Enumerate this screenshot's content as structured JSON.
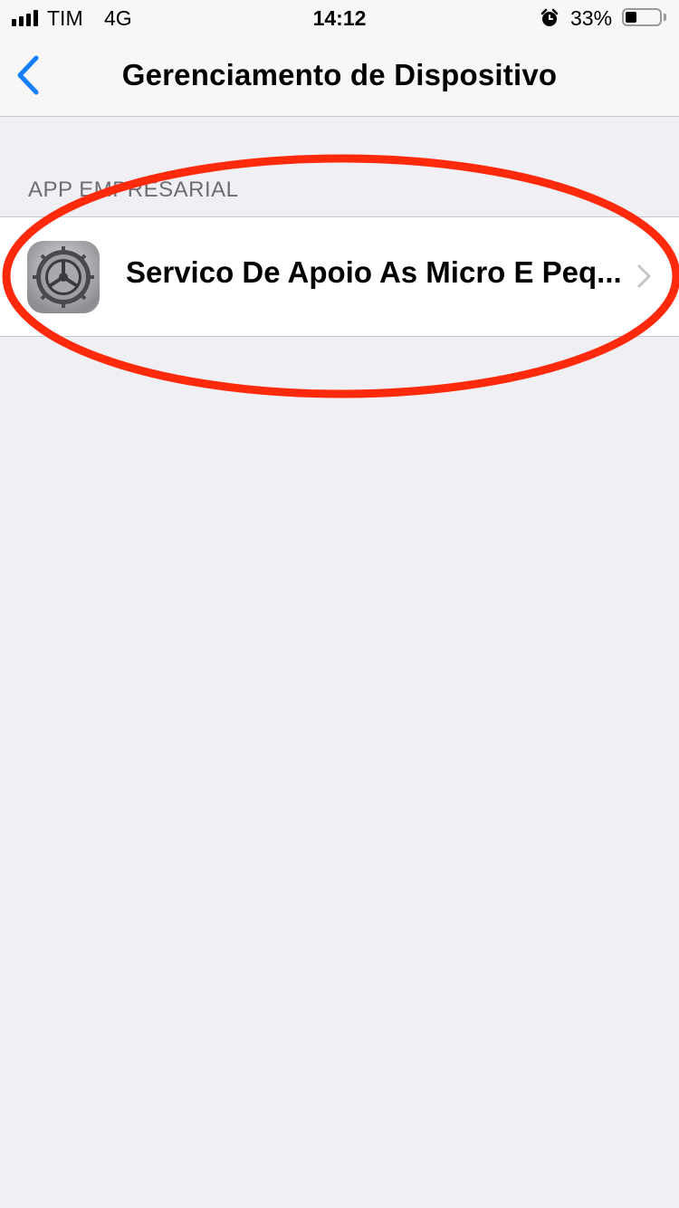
{
  "status_bar": {
    "carrier": "TIM",
    "network": "4G",
    "time": "14:12",
    "battery_percent": "33%",
    "battery_level": 0.33,
    "icons": [
      "signal-icon",
      "alarm-icon",
      "battery-icon"
    ]
  },
  "nav": {
    "title": "Gerenciamento de Dispositivo",
    "back_icon": "chevron-left-icon",
    "accent_color": "#157efb"
  },
  "section": {
    "header": "APP EMPRESARIAL",
    "items": [
      {
        "label": "Servico De Apoio As Micro E Peq...",
        "icon": "settings-gear-icon",
        "accessory": "chevron-right-icon"
      }
    ]
  },
  "annotation": {
    "shape": "ellipse",
    "color": "#ff2a0c"
  }
}
